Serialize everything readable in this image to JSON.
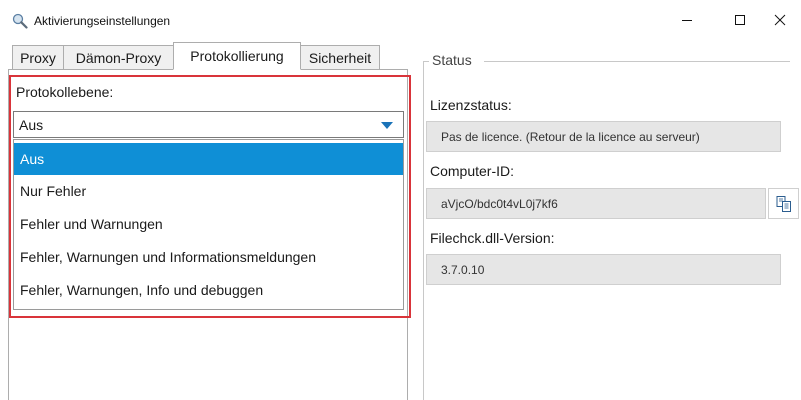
{
  "window": {
    "title": "Aktivierungseinstellungen",
    "icon": "magnifier-icon",
    "controls": [
      "minimize",
      "maximize",
      "close"
    ]
  },
  "tabs": [
    {
      "label": "Proxy",
      "active": false
    },
    {
      "label": "Dämon-Proxy",
      "active": false
    },
    {
      "label": "Protokollierung",
      "active": true
    },
    {
      "label": "Sicherheit",
      "active": false
    }
  ],
  "logging": {
    "level_label": "Protokollebene:",
    "selected_value": "Aus",
    "options": [
      "Aus",
      "Nur Fehler",
      "Fehler und Warnungen",
      "Fehler, Warnungen und Informationsmeldungen",
      "Fehler, Warnungen, Info und debuggen"
    ]
  },
  "status": {
    "group_title": "Status",
    "license_label": "Lizenzstatus:",
    "license_value": "Pas de licence. (Retour de la licence au serveur)",
    "computer_id_label": "Computer-ID:",
    "computer_id_value": "aVjcO/bdc0t4vL0j7kf6",
    "dll_label": "Filechck.dll-Version:",
    "dll_value": "3.7.0.10"
  },
  "colors": {
    "accent": "#0f8fd6",
    "highlight_border": "#d9343a",
    "readonly_field": "#e6e6e6"
  }
}
